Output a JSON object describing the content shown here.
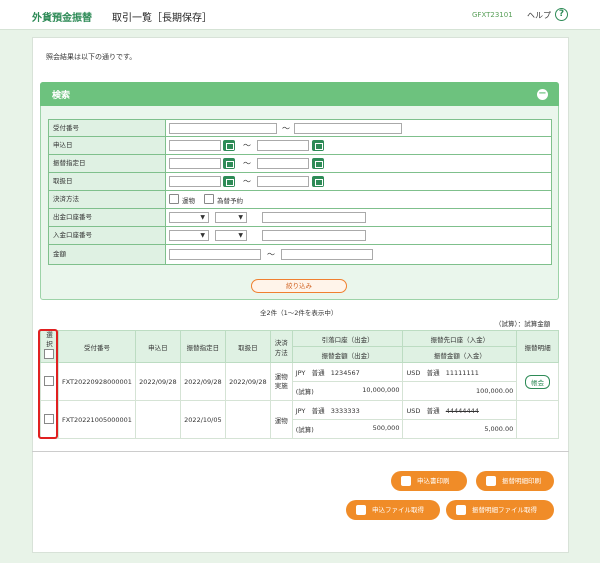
{
  "header": {
    "brand": "外貨預金振替",
    "title": "取引一覧［長期保存］",
    "code": "GFXT23101",
    "help": "ヘルプ",
    "help_icon": "?"
  },
  "intro": "照会結果は以下の通りです。",
  "search": {
    "title": "検索",
    "collapse_icon": "−",
    "rows": {
      "receipt_no": "受付番号",
      "apply_date": "申込日",
      "transfer_date": "振替指定日",
      "handle_date": "取扱日",
      "settlement": "決済方法",
      "out_account": "出金口座番号",
      "in_account": "入金口座番号",
      "amount": "金額"
    },
    "tilde": "〜",
    "settlement_opts": [
      "運物",
      "為替予約"
    ],
    "filter_button": "絞り込み"
  },
  "results": {
    "count_text": "全2件（1〜2件を表示中）",
    "trial_note": "（試算）：試算金額",
    "headers": {
      "select": "選\n択",
      "receipt": "受付番号",
      "apply": "申込日",
      "transfer": "振替指定日",
      "handle": "取扱日",
      "settle": "決済\n方法",
      "debit": "引落口座（出金）",
      "debit_amt": "振替金額（出金）",
      "credit": "振替先口座（入金）",
      "credit_amt": "振替金額（入金）",
      "detail": "振替明細"
    },
    "rows": [
      {
        "receipt": "FXT20220928000001",
        "apply": "2022/09/28",
        "transfer": "2022/09/28",
        "handle": "2022/09/28",
        "settle": "運物\n実施",
        "debit_cur": "JPY",
        "debit_type": "普通",
        "debit_no": "1234567",
        "debit_trial": "(試算)",
        "debit_amt": "10,000,000",
        "credit_cur": "USD",
        "credit_type": "普通",
        "credit_no": "11111111",
        "credit_amt": "100,000.00",
        "detail": "帳会"
      },
      {
        "receipt": "FXT20221005000001",
        "apply": "",
        "transfer": "2022/10/05",
        "handle": "",
        "settle": "運物",
        "debit_cur": "JPY",
        "debit_type": "普通",
        "debit_no": "3333333",
        "debit_trial": "(試算)",
        "debit_amt": "500,000",
        "credit_cur": "USD",
        "credit_type": "普通",
        "credit_no": "44444444",
        "credit_amt": "5,000.00",
        "detail": ""
      }
    ]
  },
  "buttons": {
    "print_apply": "申込書印刷",
    "print_detail": "振替明細印刷",
    "get_apply_file": "申込ファイル取得",
    "get_detail_file": "振替明細ファイル取得"
  }
}
